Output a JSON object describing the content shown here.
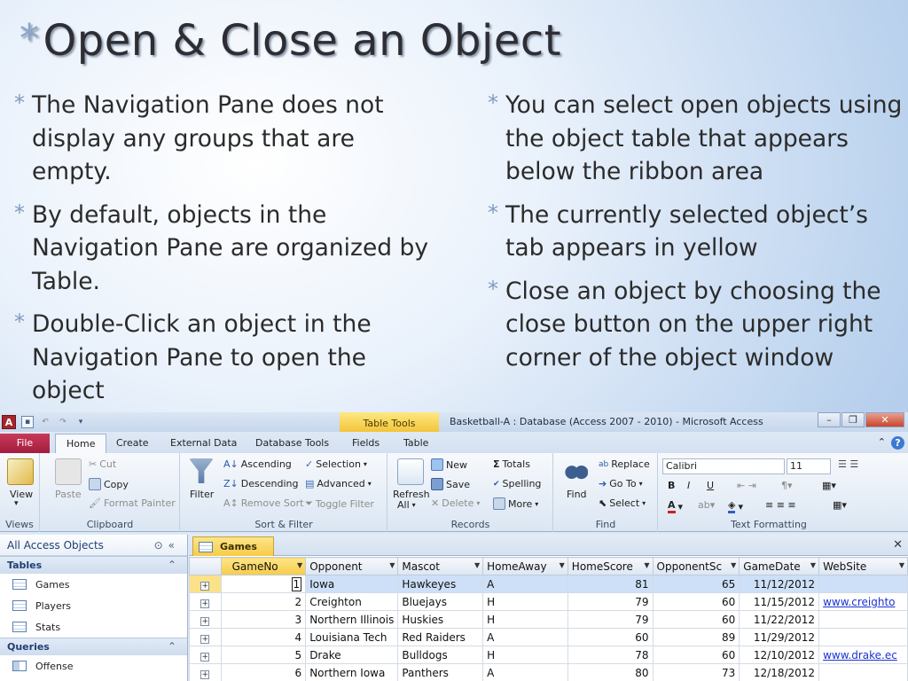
{
  "slide": {
    "title": "Open & Close an Object",
    "left_bullets": [
      "The Navigation Pane does not display any groups that are empty.",
      "By default, objects in the Navigation Pane are organized by Table.",
      "Double-Click an object in the Navigation Pane to open the object"
    ],
    "right_bullets": [
      "You can select open objects using the object table that appears below the ribbon area",
      "The currently selected object’s tab appears in yellow",
      "Close an object by choosing the close button on the upper right corner of the object window"
    ]
  },
  "window": {
    "title": "Basketball-A : Database (Access 2007 - 2010)  -  Microsoft Access",
    "context_tab": "Table Tools",
    "app_icon": "A"
  },
  "ribbon_tabs": {
    "file": "File",
    "home": "Home",
    "create": "Create",
    "external": "External Data",
    "dbtools": "Database Tools",
    "fields": "Fields",
    "table": "Table"
  },
  "ribbon": {
    "views": {
      "label": "Views",
      "view": "View"
    },
    "clipboard": {
      "label": "Clipboard",
      "paste": "Paste",
      "cut": "Cut",
      "copy": "Copy",
      "format_painter": "Format Painter"
    },
    "sortfilter": {
      "label": "Sort & Filter",
      "filter": "Filter",
      "ascending": "Ascending",
      "descending": "Descending",
      "remove_sort": "Remove Sort",
      "selection": "Selection",
      "advanced": "Advanced",
      "toggle_filter": "Toggle Filter"
    },
    "records": {
      "label": "Records",
      "refresh": "Refresh",
      "refresh2": "All",
      "new": "New",
      "save": "Save",
      "delete": "Delete",
      "totals": "Totals",
      "spelling": "Spelling",
      "more": "More"
    },
    "find": {
      "label": "Find",
      "find": "Find",
      "replace": "Replace",
      "goto": "Go To",
      "select": "Select"
    },
    "textfmt": {
      "label": "Text Formatting",
      "font": "Calibri",
      "size": "11"
    }
  },
  "nav": {
    "header": "All Access Objects",
    "tables_label": "Tables",
    "tables": [
      "Games",
      "Players",
      "Stats"
    ],
    "queries_label": "Queries",
    "queries": [
      "Offense"
    ]
  },
  "object_tab": "Games",
  "colors": {
    "selected_tab": "#f6cc48",
    "file_tab": "#a31d3e",
    "link": "#1a33d1"
  },
  "grid": {
    "columns": [
      "GameNo",
      "Opponent",
      "Mascot",
      "HomeAway",
      "HomeScore",
      "OpponentSc",
      "GameDate",
      "WebSite"
    ],
    "rows": [
      [
        "1",
        "Iowa",
        "Hawkeyes",
        "A",
        "81",
        "65",
        "11/12/2012",
        ""
      ],
      [
        "2",
        "Creighton",
        "Bluejays",
        "H",
        "79",
        "60",
        "11/15/2012",
        "www.creighto"
      ],
      [
        "3",
        "Northern Illinois",
        "Huskies",
        "H",
        "79",
        "60",
        "11/22/2012",
        ""
      ],
      [
        "4",
        "Louisiana Tech",
        "Red Raiders",
        "A",
        "60",
        "89",
        "11/29/2012",
        ""
      ],
      [
        "5",
        "Drake",
        "Bulldogs",
        "H",
        "78",
        "60",
        "12/10/2012",
        "www.drake.ec"
      ],
      [
        "6",
        "Northern Iowa",
        "Panthers",
        "A",
        "80",
        "73",
        "12/18/2012",
        ""
      ]
    ]
  }
}
